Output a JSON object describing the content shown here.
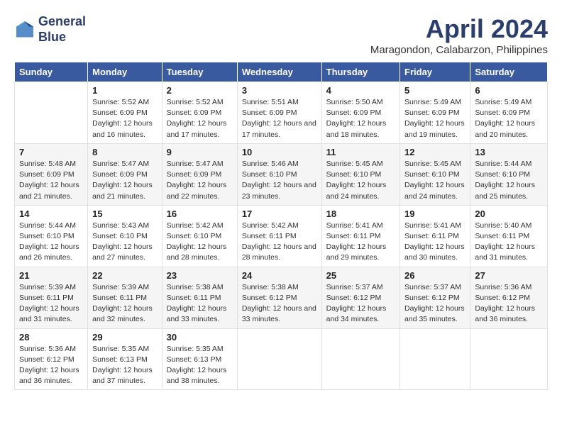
{
  "logo": {
    "line1": "General",
    "line2": "Blue"
  },
  "title": "April 2024",
  "location": "Maragondon, Calabarzon, Philippines",
  "days_of_week": [
    "Sunday",
    "Monday",
    "Tuesday",
    "Wednesday",
    "Thursday",
    "Friday",
    "Saturday"
  ],
  "weeks": [
    [
      {
        "date": "",
        "sunrise": "",
        "sunset": "",
        "daylight": ""
      },
      {
        "date": "1",
        "sunrise": "Sunrise: 5:52 AM",
        "sunset": "Sunset: 6:09 PM",
        "daylight": "Daylight: 12 hours and 16 minutes."
      },
      {
        "date": "2",
        "sunrise": "Sunrise: 5:52 AM",
        "sunset": "Sunset: 6:09 PM",
        "daylight": "Daylight: 12 hours and 17 minutes."
      },
      {
        "date": "3",
        "sunrise": "Sunrise: 5:51 AM",
        "sunset": "Sunset: 6:09 PM",
        "daylight": "Daylight: 12 hours and 17 minutes."
      },
      {
        "date": "4",
        "sunrise": "Sunrise: 5:50 AM",
        "sunset": "Sunset: 6:09 PM",
        "daylight": "Daylight: 12 hours and 18 minutes."
      },
      {
        "date": "5",
        "sunrise": "Sunrise: 5:49 AM",
        "sunset": "Sunset: 6:09 PM",
        "daylight": "Daylight: 12 hours and 19 minutes."
      },
      {
        "date": "6",
        "sunrise": "Sunrise: 5:49 AM",
        "sunset": "Sunset: 6:09 PM",
        "daylight": "Daylight: 12 hours and 20 minutes."
      }
    ],
    [
      {
        "date": "7",
        "sunrise": "Sunrise: 5:48 AM",
        "sunset": "Sunset: 6:09 PM",
        "daylight": "Daylight: 12 hours and 21 minutes."
      },
      {
        "date": "8",
        "sunrise": "Sunrise: 5:47 AM",
        "sunset": "Sunset: 6:09 PM",
        "daylight": "Daylight: 12 hours and 21 minutes."
      },
      {
        "date": "9",
        "sunrise": "Sunrise: 5:47 AM",
        "sunset": "Sunset: 6:09 PM",
        "daylight": "Daylight: 12 hours and 22 minutes."
      },
      {
        "date": "10",
        "sunrise": "Sunrise: 5:46 AM",
        "sunset": "Sunset: 6:10 PM",
        "daylight": "Daylight: 12 hours and 23 minutes."
      },
      {
        "date": "11",
        "sunrise": "Sunrise: 5:45 AM",
        "sunset": "Sunset: 6:10 PM",
        "daylight": "Daylight: 12 hours and 24 minutes."
      },
      {
        "date": "12",
        "sunrise": "Sunrise: 5:45 AM",
        "sunset": "Sunset: 6:10 PM",
        "daylight": "Daylight: 12 hours and 24 minutes."
      },
      {
        "date": "13",
        "sunrise": "Sunrise: 5:44 AM",
        "sunset": "Sunset: 6:10 PM",
        "daylight": "Daylight: 12 hours and 25 minutes."
      }
    ],
    [
      {
        "date": "14",
        "sunrise": "Sunrise: 5:44 AM",
        "sunset": "Sunset: 6:10 PM",
        "daylight": "Daylight: 12 hours and 26 minutes."
      },
      {
        "date": "15",
        "sunrise": "Sunrise: 5:43 AM",
        "sunset": "Sunset: 6:10 PM",
        "daylight": "Daylight: 12 hours and 27 minutes."
      },
      {
        "date": "16",
        "sunrise": "Sunrise: 5:42 AM",
        "sunset": "Sunset: 6:10 PM",
        "daylight": "Daylight: 12 hours and 28 minutes."
      },
      {
        "date": "17",
        "sunrise": "Sunrise: 5:42 AM",
        "sunset": "Sunset: 6:11 PM",
        "daylight": "Daylight: 12 hours and 28 minutes."
      },
      {
        "date": "18",
        "sunrise": "Sunrise: 5:41 AM",
        "sunset": "Sunset: 6:11 PM",
        "daylight": "Daylight: 12 hours and 29 minutes."
      },
      {
        "date": "19",
        "sunrise": "Sunrise: 5:41 AM",
        "sunset": "Sunset: 6:11 PM",
        "daylight": "Daylight: 12 hours and 30 minutes."
      },
      {
        "date": "20",
        "sunrise": "Sunrise: 5:40 AM",
        "sunset": "Sunset: 6:11 PM",
        "daylight": "Daylight: 12 hours and 31 minutes."
      }
    ],
    [
      {
        "date": "21",
        "sunrise": "Sunrise: 5:39 AM",
        "sunset": "Sunset: 6:11 PM",
        "daylight": "Daylight: 12 hours and 31 minutes."
      },
      {
        "date": "22",
        "sunrise": "Sunrise: 5:39 AM",
        "sunset": "Sunset: 6:11 PM",
        "daylight": "Daylight: 12 hours and 32 minutes."
      },
      {
        "date": "23",
        "sunrise": "Sunrise: 5:38 AM",
        "sunset": "Sunset: 6:11 PM",
        "daylight": "Daylight: 12 hours and 33 minutes."
      },
      {
        "date": "24",
        "sunrise": "Sunrise: 5:38 AM",
        "sunset": "Sunset: 6:12 PM",
        "daylight": "Daylight: 12 hours and 33 minutes."
      },
      {
        "date": "25",
        "sunrise": "Sunrise: 5:37 AM",
        "sunset": "Sunset: 6:12 PM",
        "daylight": "Daylight: 12 hours and 34 minutes."
      },
      {
        "date": "26",
        "sunrise": "Sunrise: 5:37 AM",
        "sunset": "Sunset: 6:12 PM",
        "daylight": "Daylight: 12 hours and 35 minutes."
      },
      {
        "date": "27",
        "sunrise": "Sunrise: 5:36 AM",
        "sunset": "Sunset: 6:12 PM",
        "daylight": "Daylight: 12 hours and 36 minutes."
      }
    ],
    [
      {
        "date": "28",
        "sunrise": "Sunrise: 5:36 AM",
        "sunset": "Sunset: 6:12 PM",
        "daylight": "Daylight: 12 hours and 36 minutes."
      },
      {
        "date": "29",
        "sunrise": "Sunrise: 5:35 AM",
        "sunset": "Sunset: 6:13 PM",
        "daylight": "Daylight: 12 hours and 37 minutes."
      },
      {
        "date": "30",
        "sunrise": "Sunrise: 5:35 AM",
        "sunset": "Sunset: 6:13 PM",
        "daylight": "Daylight: 12 hours and 38 minutes."
      },
      {
        "date": "",
        "sunrise": "",
        "sunset": "",
        "daylight": ""
      },
      {
        "date": "",
        "sunrise": "",
        "sunset": "",
        "daylight": ""
      },
      {
        "date": "",
        "sunrise": "",
        "sunset": "",
        "daylight": ""
      },
      {
        "date": "",
        "sunrise": "",
        "sunset": "",
        "daylight": ""
      }
    ]
  ]
}
